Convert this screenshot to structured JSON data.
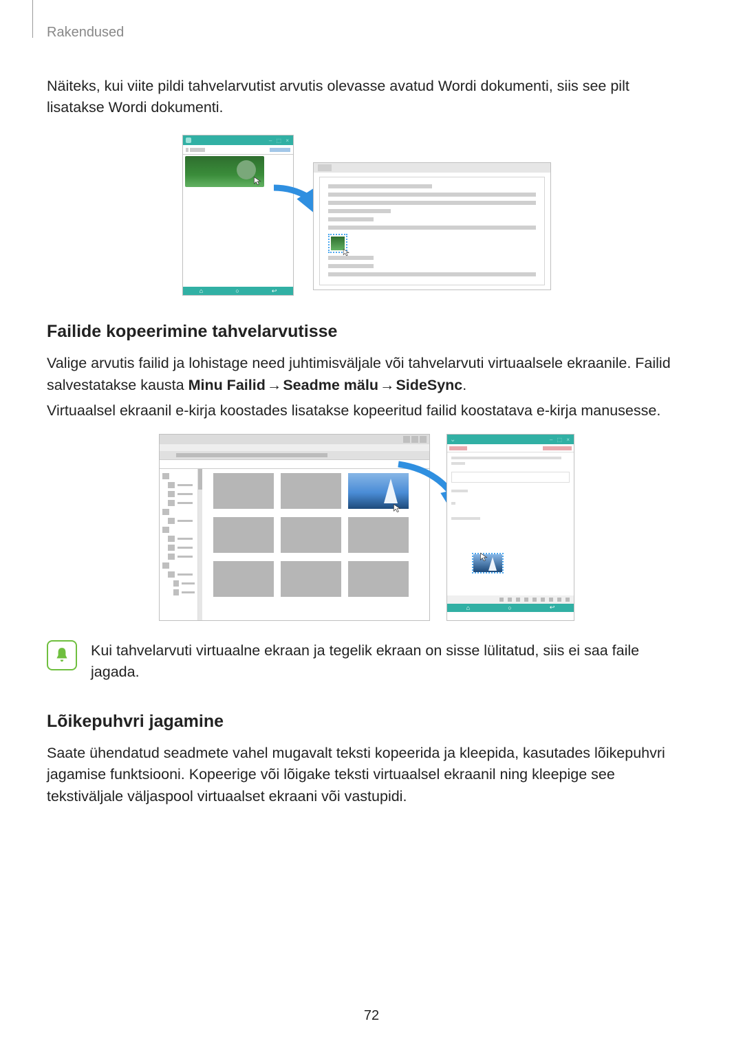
{
  "header": "Rakendused",
  "intro": "Näiteks, kui viite pildi tahvelarvutist arvutis olevasse avatud Wordi dokumenti, siis see pilt lisatakse Wordi dokumenti.",
  "section1": {
    "title": "Failide kopeerimine tahvelarvutisse",
    "p1a": "Valige arvutis failid ja lohistage need juhtimisväljale või tahvelarvuti virtuaalsele ekraanile. Failid salvestatakse kausta ",
    "bold1": "Minu Failid",
    "arrow": " → ",
    "bold2": "Seadme mälu",
    "bold3": "SideSync",
    "p1_end": ".",
    "p2": "Virtuaalsel ekraanil e-kirja koostades lisatakse kopeeritud failid koostatava e-kirja manusesse."
  },
  "note": "Kui tahvelarvuti virtuaalne ekraan ja tegelik ekraan on sisse lülitatud, siis ei saa faile jagada.",
  "section2": {
    "title": "Lõikepuhvri jagamine",
    "p1": "Saate ühendatud seadmete vahel mugavalt teksti kopeerida ja kleepida, kasutades lõikepuhvri jagamise funktsiooni. Kopeerige või lõigake teksti virtuaalsel ekraanil ning kleepige see tekstiväljale väljaspool virtuaalset ekraani või vastupidi."
  },
  "page": "72"
}
